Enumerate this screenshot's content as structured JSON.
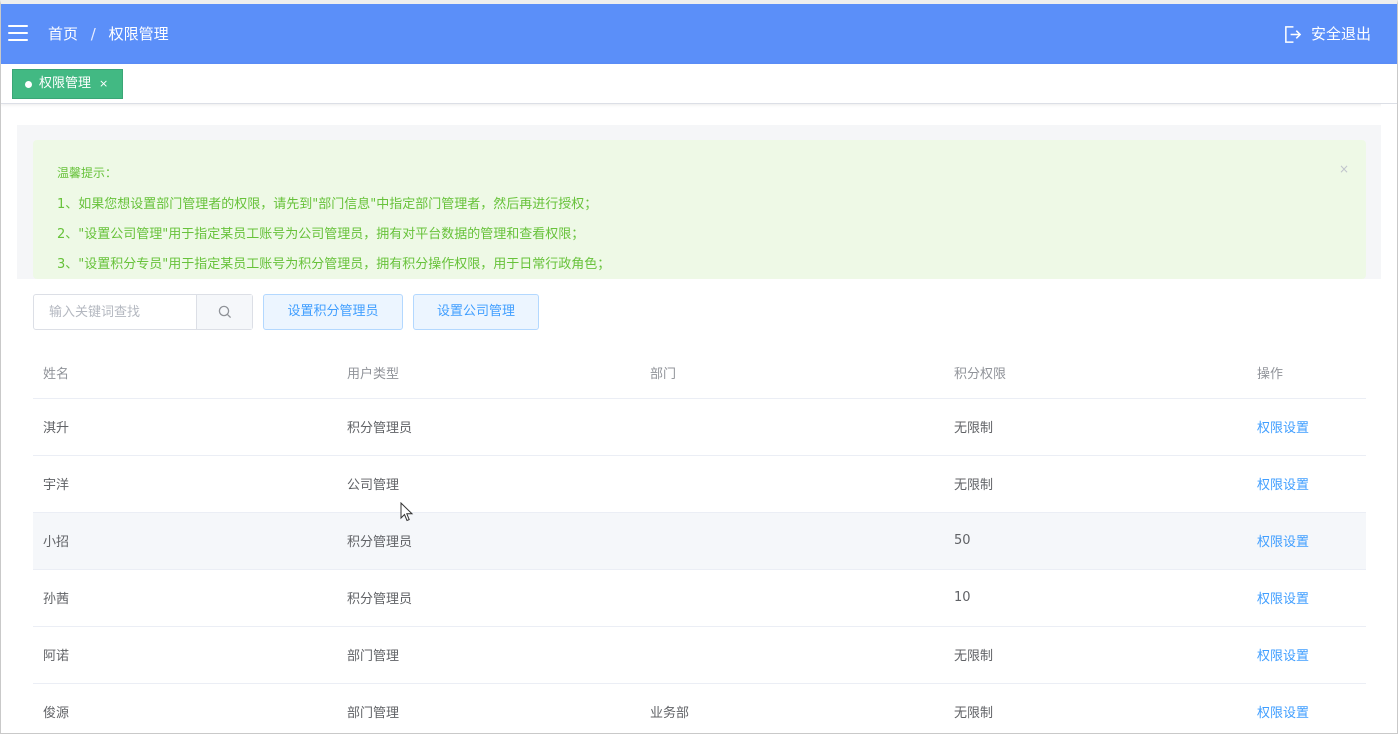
{
  "header": {
    "breadcrumb": [
      "首页",
      "权限管理"
    ],
    "separator": "/",
    "logout_label": "安全退出",
    "background_color": "#5b8ff9"
  },
  "tabs": [
    {
      "label": "权限管理",
      "close": "×",
      "active": true,
      "color": "#42b983"
    }
  ],
  "alert": {
    "title": "温馨提示：",
    "close": "×",
    "lines": [
      "1、如果您想设置部门管理者的权限，请先到\"部门信息\"中指定部门管理者，然后再进行授权；",
      "2、\"设置公司管理\"用于指定某员工账号为公司管理员，拥有对平台数据的管理和查看权限；",
      "3、\"设置积分专员\"用于指定某员工账号为积分管理员，拥有积分操作权限，用于日常行政角色；"
    ]
  },
  "toolbar": {
    "search_placeholder": "输入关键词查找",
    "search_icon": "search-icon",
    "btn_points_admin": "设置积分管理员",
    "btn_company_admin": "设置公司管理"
  },
  "table": {
    "columns": [
      "姓名",
      "用户类型",
      "部门",
      "积分权限",
      "操作"
    ],
    "rows": [
      {
        "name": "淇升",
        "type": "积分管理员",
        "dept": "",
        "points": "无限制",
        "action": "权限设置"
      },
      {
        "name": "宇洋",
        "type": "公司管理",
        "dept": "",
        "points": "无限制",
        "action": "权限设置"
      },
      {
        "name": "小招",
        "type": "积分管理员",
        "dept": "",
        "points": "50",
        "action": "权限设置"
      },
      {
        "name": "孙茜",
        "type": "积分管理员",
        "dept": "",
        "points": "10",
        "action": "权限设置"
      },
      {
        "name": "阿诺",
        "type": "部门管理",
        "dept": "",
        "points": "无限制",
        "action": "权限设置"
      },
      {
        "name": "俊源",
        "type": "部门管理",
        "dept": "业务部",
        "points": "无限制",
        "action": "权限设置"
      }
    ]
  }
}
